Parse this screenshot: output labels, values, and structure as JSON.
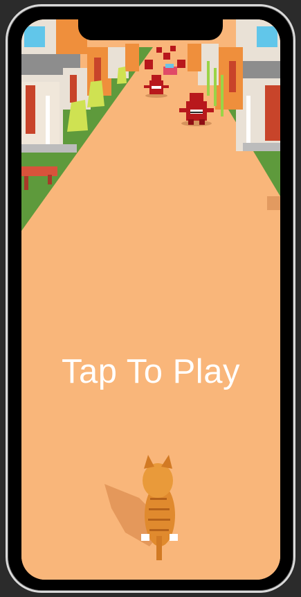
{
  "game": {
    "prompt": "Tap To Play"
  },
  "palette": {
    "road": "#f9b67a",
    "grass": "#5e9a3c",
    "curb": "#bcbcbc",
    "house_wall": "#e9e1d6",
    "house_roof": "#9a9a9a",
    "door": "#c8442a",
    "bush": "#cfe252",
    "enemy": "#b8181c",
    "cat": "#e08a2e"
  },
  "icons": {
    "player": "orange-cat-icon",
    "enemy": "red-monster-icon"
  }
}
